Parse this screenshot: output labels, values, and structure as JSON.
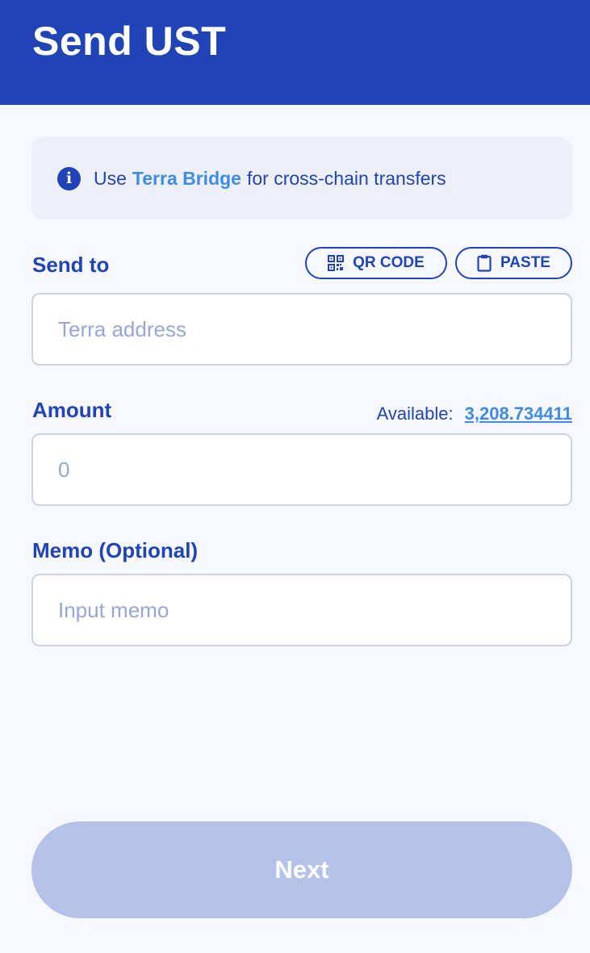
{
  "header": {
    "title": "Send UST"
  },
  "notice": {
    "prefix": "Use",
    "link": "Terra Bridge",
    "suffix": "for cross-chain transfers",
    "icon": "info-icon"
  },
  "send_to": {
    "label": "Send to",
    "placeholder": "Terra address",
    "qr_button": "QR CODE",
    "paste_button": "PASTE"
  },
  "amount": {
    "label": "Amount",
    "available_label": "Available:",
    "available_value": "3,208.734411",
    "placeholder": "0"
  },
  "memo": {
    "label": "Memo (Optional)",
    "placeholder": "Input memo"
  },
  "next_button": "Next",
  "colors": {
    "primary": "#2043b5",
    "link": "#3f8be6",
    "disabled_button": "#b5c2e8",
    "background": "#f7f8fd"
  }
}
